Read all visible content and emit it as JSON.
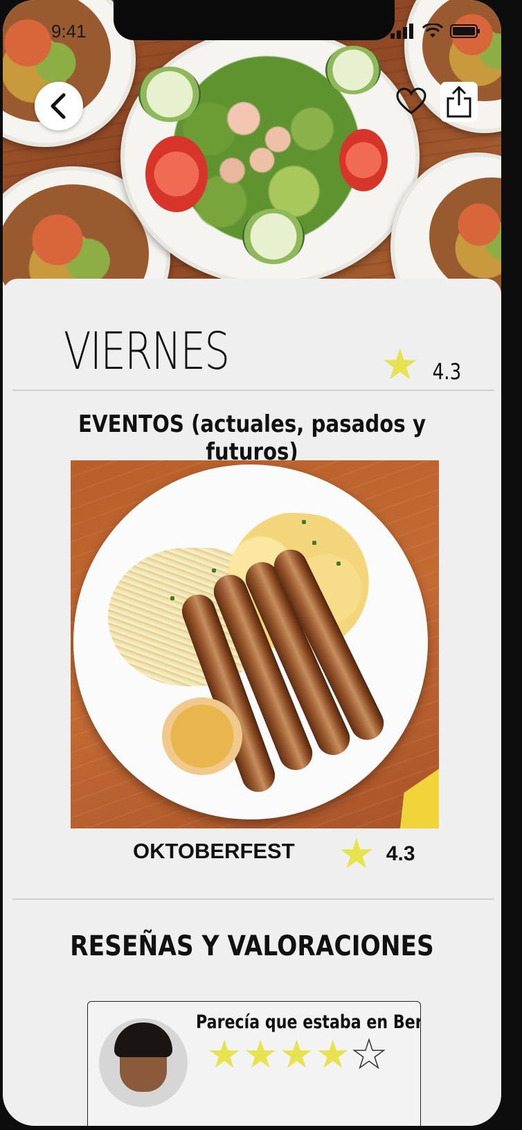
{
  "status_bar": {
    "time": "9:41"
  },
  "header": {
    "back_icon": "chevron-left-icon",
    "favorite_icon": "heart-icon",
    "share_icon": "share-icon"
  },
  "venue": {
    "name": "VIERNES",
    "rating": "4.3"
  },
  "events": {
    "section_title": "EVENTOS (actuales, pasados y futuros)",
    "items": [
      {
        "name": "OKTOBERFEST",
        "rating": "4.3"
      }
    ]
  },
  "reviews": {
    "section_title": "RESEÑAS Y VALORACIONES",
    "items": [
      {
        "title": "Parecía que estaba en Berlín",
        "stars": 4,
        "max_stars": 5
      }
    ]
  },
  "colors": {
    "star": "#e6e34e",
    "background": "#efefef",
    "text": "#111111"
  }
}
